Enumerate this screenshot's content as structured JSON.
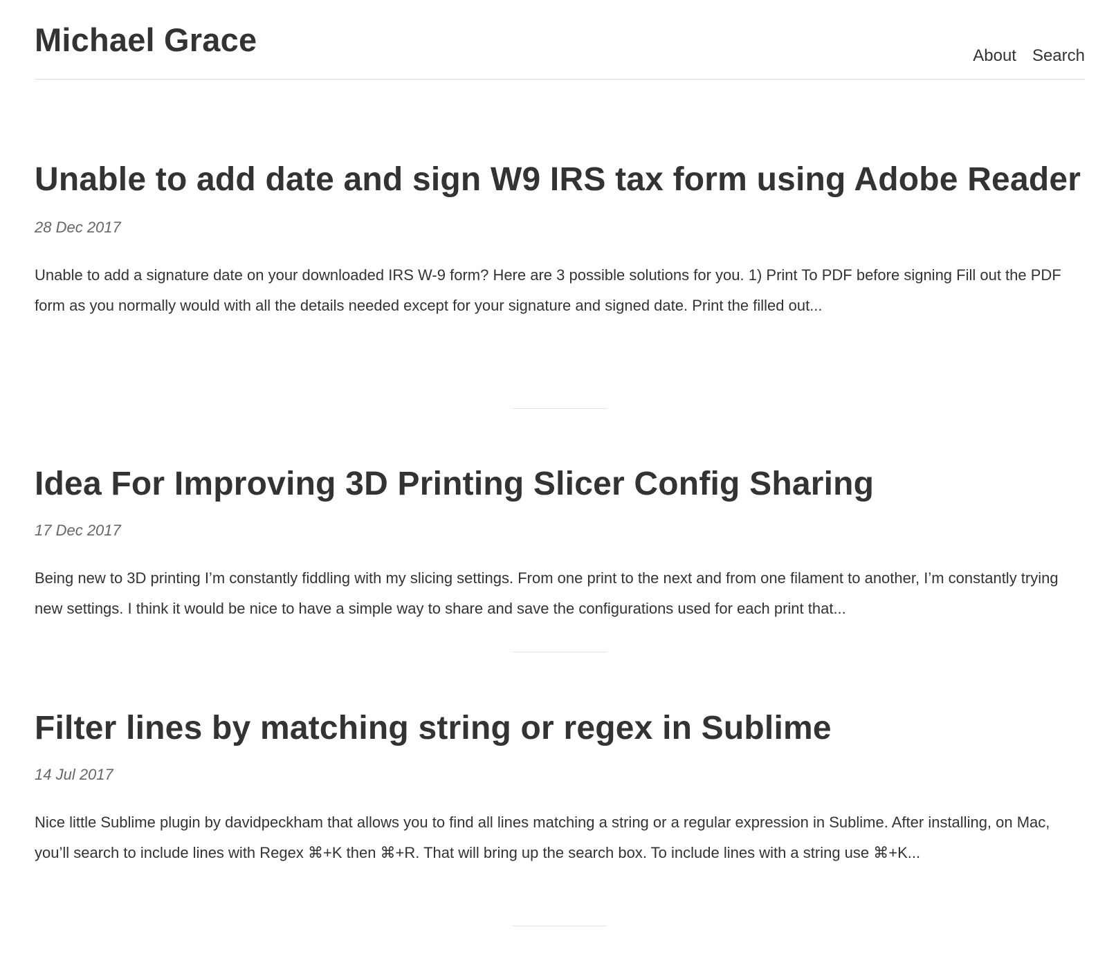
{
  "site": {
    "title": "Michael Grace"
  },
  "nav": {
    "about": "About",
    "search": "Search"
  },
  "posts": [
    {
      "title": "Unable to add date and sign W9 IRS tax form using Adobe Reader",
      "date": "28 Dec 2017",
      "excerpt": "Unable to add a signature date on your downloaded IRS W-9  form? Here are 3 possible solutions for you. 1) Print To PDF before signing Fill out the PDF form as you normally would with all the details needed except for your signature and signed date. Print the filled out..."
    },
    {
      "title": "Idea For Improving 3D Printing Slicer Config Sharing",
      "date": "17 Dec 2017",
      "excerpt": "Being new to 3D printing I’m constantly fiddling with my slicing settings. From one print to the next and from one filament to another, I’m constantly trying new settings. I think it would be nice to have a simple way to share and save the configurations used for each print that..."
    },
    {
      "title": "Filter lines by matching string or regex in Sublime",
      "date": "14 Jul 2017",
      "excerpt": "Nice little Sublime plugin by davidpeckham that allows you to find all lines matching a string or a regular expression in Sublime. After installing, on Mac, you’ll search to include lines with Regex ⌘+K then ⌘+R. That will bring up the search box. To include lines with a string use ⌘+K..."
    }
  ]
}
